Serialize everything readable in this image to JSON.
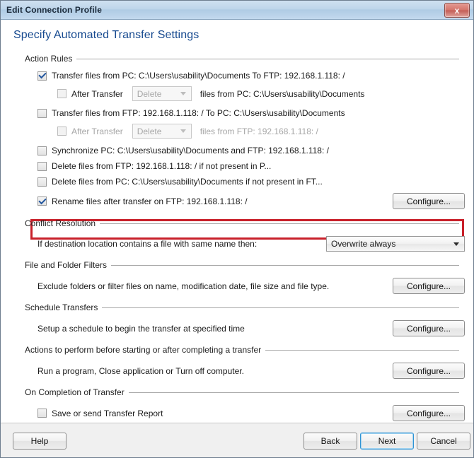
{
  "window": {
    "title": "Edit Connection Profile",
    "close_label": "x",
    "close_icon": "close-icon"
  },
  "page": {
    "title": "Specify Automated Transfer Settings"
  },
  "action_rules": {
    "group_label": "Action Rules",
    "rule1": {
      "checked": true,
      "label": "Transfer files from PC: C:\\Users\\usability\\Documents  To  FTP: 192.168.1.118: /",
      "sub": {
        "checked": false,
        "label": "After Transfer",
        "combo_value": "Delete",
        "suffix": "files from PC: C:\\Users\\usability\\Documents"
      }
    },
    "rule2": {
      "checked": false,
      "label": "Transfer files from FTP: 192.168.1.118: /  To  PC: C:\\Users\\usability\\Documents",
      "sub": {
        "checked": false,
        "label": "After Transfer",
        "combo_value": "Delete",
        "suffix": "files from FTP: 192.168.1.118: /"
      }
    },
    "rule3": {
      "checked": false,
      "label": "Synchronize PC: C:\\Users\\usability\\Documents and FTP: 192.168.1.118: /"
    },
    "rule4": {
      "checked": false,
      "label": "Delete files from FTP: 192.168.1.118: / if not present in P..."
    },
    "rule5": {
      "checked": false,
      "label": "Delete files from PC: C:\\Users\\usability\\Documents if not present in FT..."
    },
    "rule6": {
      "checked": true,
      "label": "Rename files after transfer on FTP: 192.168.1.118: /",
      "button": "Configure...",
      "highlighted": true,
      "highlight_color": "#c8202a"
    }
  },
  "conflict_resolution": {
    "group_label": "Conflict Resolution",
    "prompt": "If destination location contains a file with same name then:",
    "selected": "Overwrite always"
  },
  "file_folder_filters": {
    "group_label": "File and Folder Filters",
    "description": "Exclude folders or filter files on name, modification date, file size and file type.",
    "button": "Configure..."
  },
  "schedule_transfers": {
    "group_label": "Schedule Transfers",
    "description": "Setup a schedule to begin the transfer at specified time",
    "button": "Configure..."
  },
  "actions_before_after": {
    "group_label": "Actions to perform before starting or after completing a transfer",
    "description": "Run a program, Close application or Turn off computer.",
    "button": "Configure..."
  },
  "on_completion": {
    "group_label": "On Completion of Transfer",
    "checkbox_label": "Save or send Transfer Report",
    "checked": false,
    "button": "Configure..."
  },
  "footer": {
    "help": "Help",
    "back": "Back",
    "next": "Next",
    "cancel": "Cancel"
  }
}
